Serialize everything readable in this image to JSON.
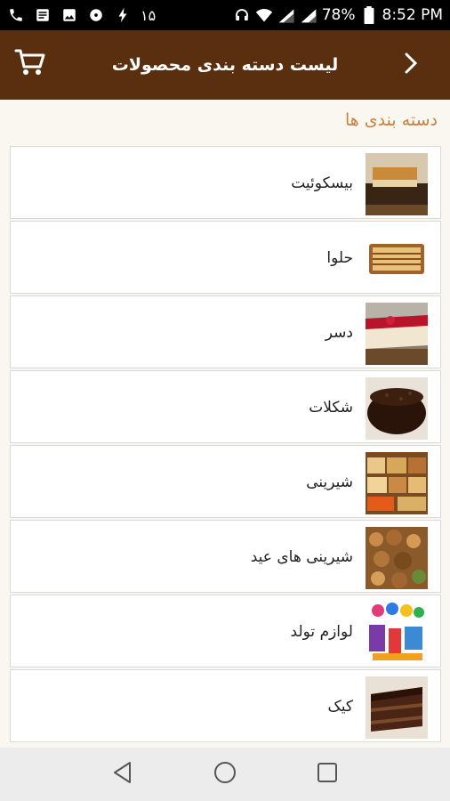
{
  "status_bar": {
    "notification_number": "۱۵",
    "battery": "78%",
    "time": "8:52 PM"
  },
  "toolbar": {
    "title": "لیست دسته بندی محصولات",
    "cart_icon": "cart-icon",
    "back_icon": "chevron-right-icon"
  },
  "section": {
    "title": "دسته بندی ها"
  },
  "categories": [
    {
      "label": "بیسکوئیت",
      "image": "biscuit-cake"
    },
    {
      "label": "حلوا",
      "image": "halva-box"
    },
    {
      "label": "دسر",
      "image": "cheesecake"
    },
    {
      "label": "شکلات",
      "image": "chocolate-cake"
    },
    {
      "label": "شیرینی",
      "image": "pastry-slices"
    },
    {
      "label": "شیرینی های عید",
      "image": "eid-cookies"
    },
    {
      "label": "لوازم تولد",
      "image": "party-supplies"
    },
    {
      "label": "کیک",
      "image": "cake-slice"
    }
  ],
  "colors": {
    "toolbar": "#5a2f10",
    "accent": "#c8813e",
    "background": "#faf6f0"
  }
}
